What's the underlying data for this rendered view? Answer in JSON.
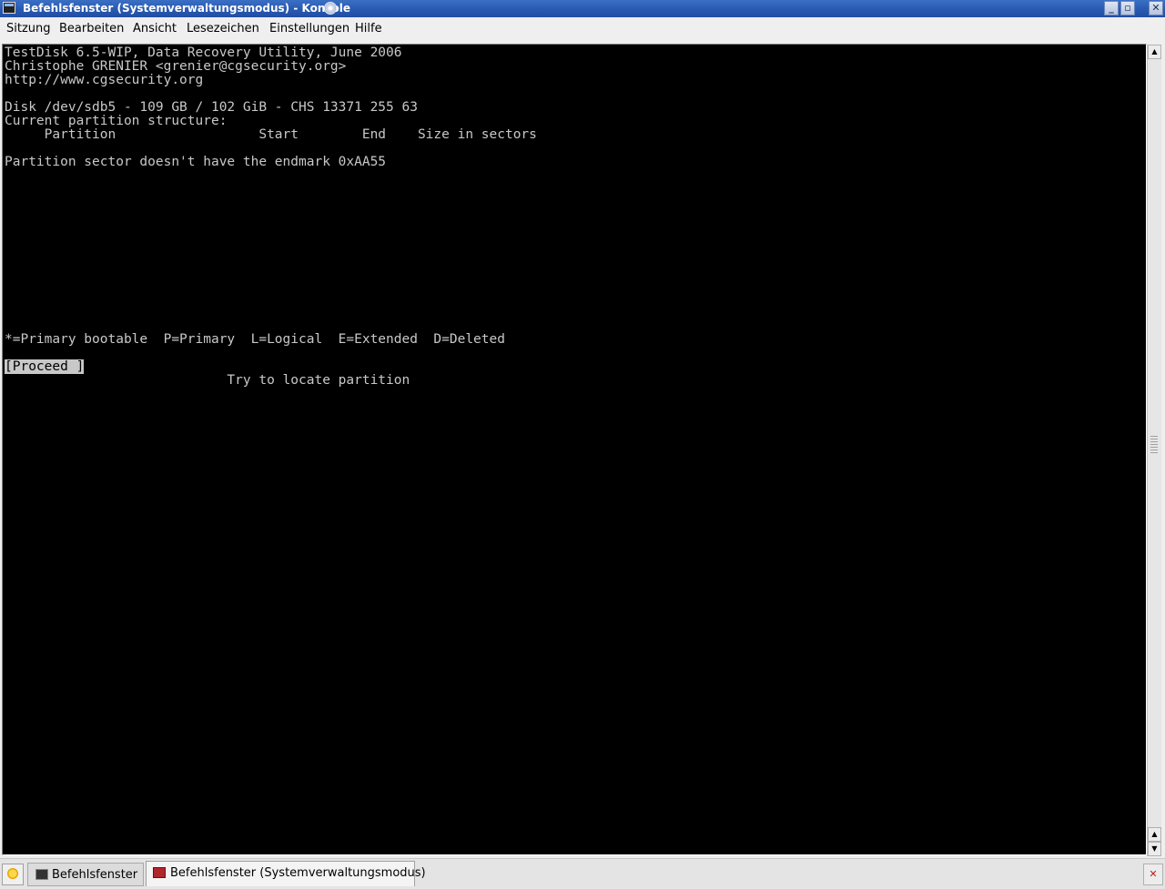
{
  "window": {
    "title": "Befehlsfenster (Systemverwaltungsmodus) - Konsole",
    "buttons": {
      "minimize": "_",
      "maximize": "▫",
      "close": "✕"
    }
  },
  "menubar": {
    "items": [
      {
        "label": "Sitzung"
      },
      {
        "label": "Bearbeiten"
      },
      {
        "label": "Ansicht"
      },
      {
        "label": "Lesezeichen"
      },
      {
        "label": "Einstellungen"
      },
      {
        "label": "Hilfe"
      }
    ]
  },
  "terminal": {
    "lines": [
      "TestDisk 6.5-WIP, Data Recovery Utility, June 2006",
      "Christophe GRENIER <grenier@cgsecurity.org>",
      "http://www.cgsecurity.org",
      "",
      "Disk /dev/sdb5 - 109 GB / 102 GiB - CHS 13371 255 63",
      "Current partition structure:",
      "     Partition                  Start        End    Size in sectors",
      "",
      "Partition sector doesn't have the endmark 0xAA55"
    ],
    "legend": "*=Primary bootable  P=Primary  L=Logical  E=Extended  D=Deleted",
    "proceed_button": "[Proceed ]",
    "hint": "                            Try to locate partition"
  },
  "scrollbar": {
    "up_arrow": "▲",
    "down_arrow": "▼"
  },
  "tabbar": {
    "tabs": [
      {
        "label": "Befehlsfenster",
        "active": false
      },
      {
        "label": "Befehlsfenster (Systemverwaltungsmodus)",
        "active": true
      }
    ],
    "close_symbol": "✕"
  },
  "colors": {
    "titlebar": "#2a5bb3",
    "terminal_bg": "#000000",
    "terminal_fg": "#c8c8c8",
    "chrome_bg": "#efefef"
  }
}
